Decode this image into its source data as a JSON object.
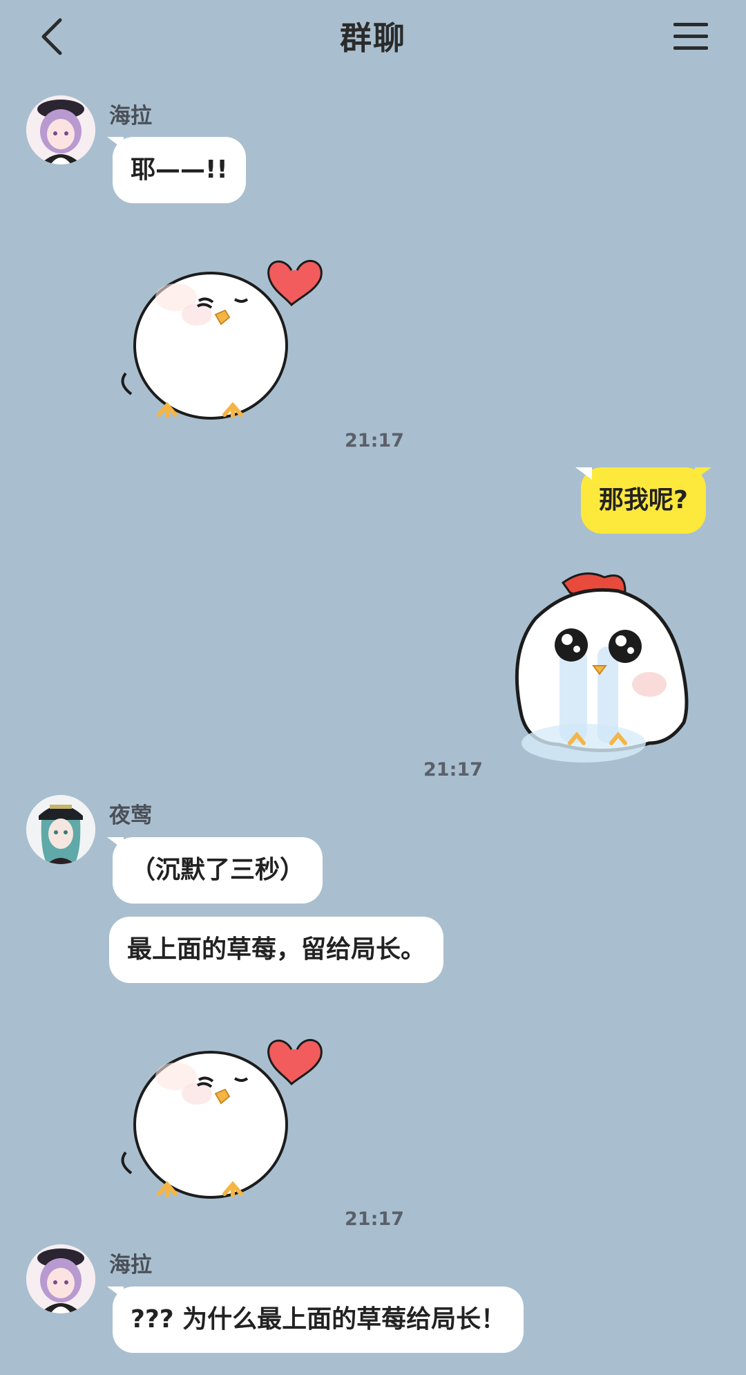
{
  "header": {
    "title": "群聊",
    "back_icon": "chevron-left-icon",
    "menu_icon": "hamburger-menu-icon"
  },
  "colors": {
    "background": "#a9bfcf",
    "bubble_other": "#ffffff",
    "bubble_self": "#fde83c",
    "heart": "#f25c5c"
  },
  "messages": [
    {
      "sender": "海拉",
      "text": "耶——!!"
    },
    {
      "sticker": "chick-heart-sticker",
      "time": "21:17"
    },
    {
      "self": true,
      "text": "那我呢?"
    },
    {
      "self": true,
      "sticker": "crying-chick-sticker",
      "time": "21:17"
    },
    {
      "sender": "夜莺",
      "text": "（沉默了三秒）"
    },
    {
      "text": "最上面的草莓，留给局长。"
    },
    {
      "sticker": "chick-heart-sticker",
      "time": "21:17"
    },
    {
      "sender": "海拉",
      "text": "??? 为什么最上面的草莓给局长！"
    }
  ]
}
